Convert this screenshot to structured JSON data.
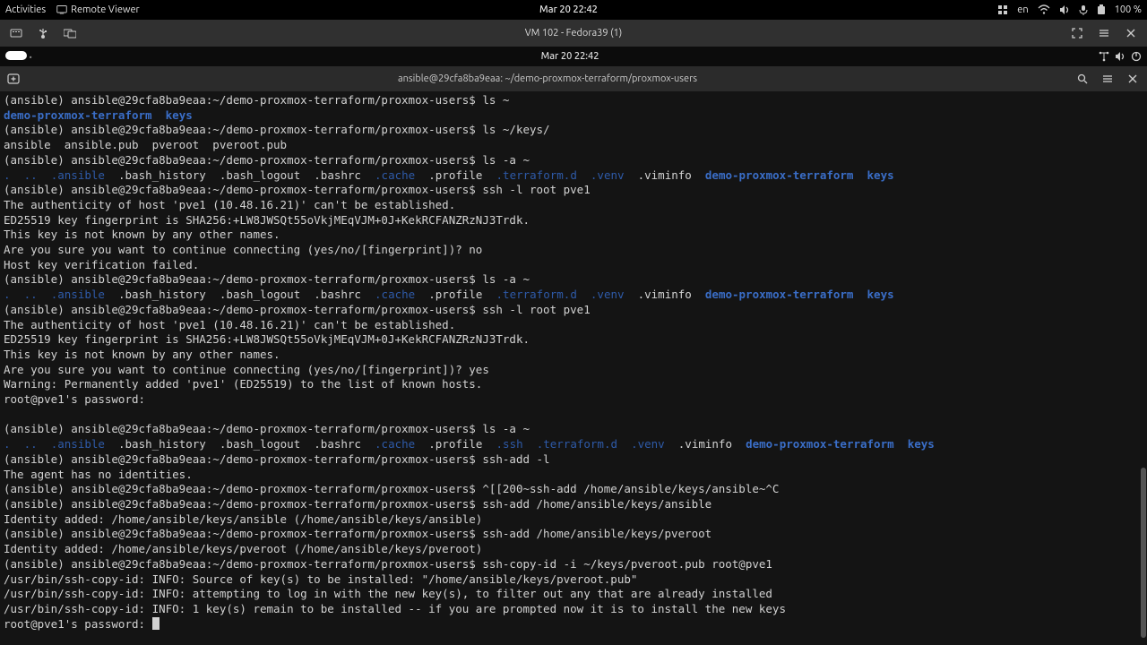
{
  "gnome_top": {
    "activities": "Activities",
    "app": "Remote Viewer",
    "clock": "Mar 20  22:42",
    "lang": "en",
    "battery": "100 %"
  },
  "viewer_win": {
    "title": "VM 102 - Fedora39 (1)"
  },
  "guest_top": {
    "clock": "Mar 20  22:42"
  },
  "term_win": {
    "title": "ansible@29cfa8ba9eaa: ~/demo-proxmox-terraform/proxmox-users"
  },
  "prompt": "(ansible) ansible@29cfa8ba9eaa:~/demo-proxmox-terraform/proxmox-users$",
  "t": {
    "cmd_ls_home": " ls ~",
    "out_ls_home_1": "demo-proxmox-terraform",
    "out_ls_home_2": "keys",
    "cmd_ls_keys": " ls ~/keys/",
    "out_ls_keys": "ansible  ansible.pub  pveroot  pveroot.pub",
    "cmd_ls_a1": " ls -a ~",
    "dot": ".",
    "dotdot": "..",
    "hid_ansible": ".ansible",
    "f_bash_history": ".bash_history",
    "f_bash_logout": ".bash_logout",
    "f_bashrc": ".bashrc",
    "hid_cache": ".cache",
    "f_profile": ".profile",
    "hid_ssh": ".ssh",
    "hid_terraformd": ".terraform.d",
    "hid_venv": ".venv",
    "f_viminfo": ".viminfo",
    "dir_demo": "demo-proxmox-terraform",
    "dir_keys": "keys",
    "cmd_ssh1": " ssh -l root pve1",
    "auth1": "The authenticity of host 'pve1 (10.48.16.21)' can't be established.",
    "fp": "ED25519 key fingerprint is SHA256:+LW8JWSQt55oVkjMEqVJM+0J+KekRCFANZRzNJ3Trdk.",
    "known": "This key is not known by any other names.",
    "cont_no": "Are you sure you want to continue connecting (yes/no/[fingerprint])? no",
    "hostfail": "Host key verification failed.",
    "cmd_ls_a2": " ls -a ~",
    "cmd_ssh2": " ssh -l root pve1",
    "cont_yes": "Are you sure you want to continue connecting (yes/no/[fingerprint])? yes",
    "warn_added": "Warning: Permanently added 'pve1' (ED25519) to the list of known hosts.",
    "pw1": "root@pve1's password: ",
    "blank": "",
    "cmd_ls_a3": " ls -a ~",
    "cmd_sshadd_l": " ssh-add -l",
    "no_ident": "The agent has no identities.",
    "cmd_cancel": " ^[[200~ssh-add /home/ansible/keys/ansible~^C",
    "cmd_sshadd_a": " ssh-add /home/ansible/keys/ansible",
    "id_added_a": "Identity added: /home/ansible/keys/ansible (/home/ansible/keys/ansible)",
    "cmd_sshadd_p": " ssh-add /home/ansible/keys/pveroot",
    "id_added_p": "Identity added: /home/ansible/keys/pveroot (/home/ansible/keys/pveroot)",
    "cmd_copyid": " ssh-copy-id -i ~/keys/pveroot.pub root@pve1",
    "copy1": "/usr/bin/ssh-copy-id: INFO: Source of key(s) to be installed: \"/home/ansible/keys/pveroot.pub\"",
    "copy2": "/usr/bin/ssh-copy-id: INFO: attempting to log in with the new key(s), to filter out any that are already installed",
    "copy3": "/usr/bin/ssh-copy-id: INFO: 1 key(s) remain to be installed -- if you are prompted now it is to install the new keys",
    "pw2": "root@pve1's password: "
  }
}
